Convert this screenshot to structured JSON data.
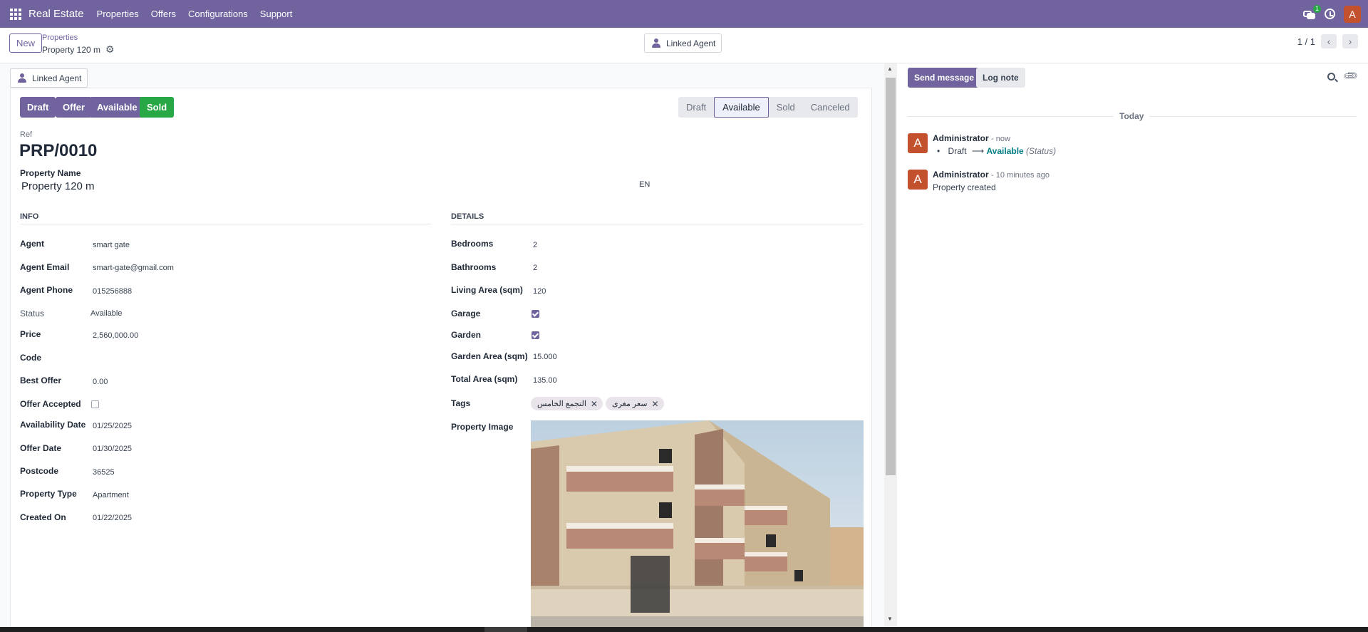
{
  "navbar": {
    "brand": "Real Estate",
    "menu": [
      "Properties",
      "Offers",
      "Configurations",
      "Support"
    ],
    "messages_badge": "1",
    "user_initial": "A",
    "icons": [
      "apps-grid-icon",
      "chat-icon",
      "clock-icon"
    ]
  },
  "control": {
    "new_label": "New",
    "breadcrumb_parent": "Properties",
    "breadcrumb_current": "Property 120 m",
    "linked_agent_label": "Linked Agent",
    "pager_value": "1 / 1"
  },
  "form": {
    "header_buttons": [
      "Draft",
      "Offer",
      "Available",
      "Sold"
    ],
    "status_stages": [
      "Draft",
      "Available",
      "Sold",
      "Canceled"
    ],
    "active_stage": "Available",
    "linked_agent_label": "Linked Agent",
    "ref_label": "Ref",
    "ref_value": "PRP/0010",
    "property_name_label": "Property Name",
    "property_name_value": "Property 120 m",
    "lang_label": "EN",
    "info_title": "INFO",
    "details_title": "DETAILS",
    "info_fields": [
      {
        "label": "Agent",
        "value": "smart gate"
      },
      {
        "label": "Agent Email",
        "value": "smart-gate@gmail.com"
      },
      {
        "label": "Agent Phone",
        "value": "015256888"
      },
      {
        "label": "Status",
        "value": "Available"
      },
      {
        "label": "Price",
        "value": "2,560,000.00"
      },
      {
        "label": "Code",
        "value": ""
      },
      {
        "label": "Best Offer",
        "value": "0.00"
      },
      {
        "label": "Offer Accepted",
        "value": ""
      },
      {
        "label": "Availability Date",
        "value": "01/25/2025"
      },
      {
        "label": "Offer Date",
        "value": "01/30/2025"
      },
      {
        "label": "Postcode",
        "value": "36525"
      },
      {
        "label": "Property Type",
        "value": "Apartment"
      },
      {
        "label": "Created On",
        "value": "01/22/2025"
      }
    ],
    "offer_accepted": false,
    "detail_fields": [
      {
        "label": "Bedrooms",
        "value": "2"
      },
      {
        "label": "Bathrooms",
        "value": "2"
      },
      {
        "label": "Living Area (sqm)",
        "value": "120"
      },
      {
        "label": "Garage",
        "value": ""
      },
      {
        "label": "Garden",
        "value": ""
      },
      {
        "label": "Garden Area (sqm)",
        "value": "15.000"
      },
      {
        "label": "Total Area (sqm)",
        "value": "135.00"
      },
      {
        "label": "Tags",
        "value": ""
      },
      {
        "label": "Property Image",
        "value": ""
      }
    ],
    "garage": true,
    "garden": true,
    "tags": [
      "التجمع الخامس",
      "سعر مغرى"
    ]
  },
  "chatter": {
    "send_message_label": "Send message",
    "log_note_label": "Log note",
    "today_label": "Today",
    "messages": [
      {
        "avatar": "A",
        "author": "Administrator",
        "time": "- now",
        "old_value": "Draft",
        "arrow": "⟶",
        "new_value": "Available",
        "field": "(Status)"
      },
      {
        "avatar": "A",
        "author": "Administrator",
        "time": "- 10 minutes ago",
        "body": "Property created"
      }
    ]
  },
  "colors": {
    "brand": "#71639e",
    "sold_button": "#28a745",
    "avatar": "#c4512e",
    "link": "#017e84"
  }
}
